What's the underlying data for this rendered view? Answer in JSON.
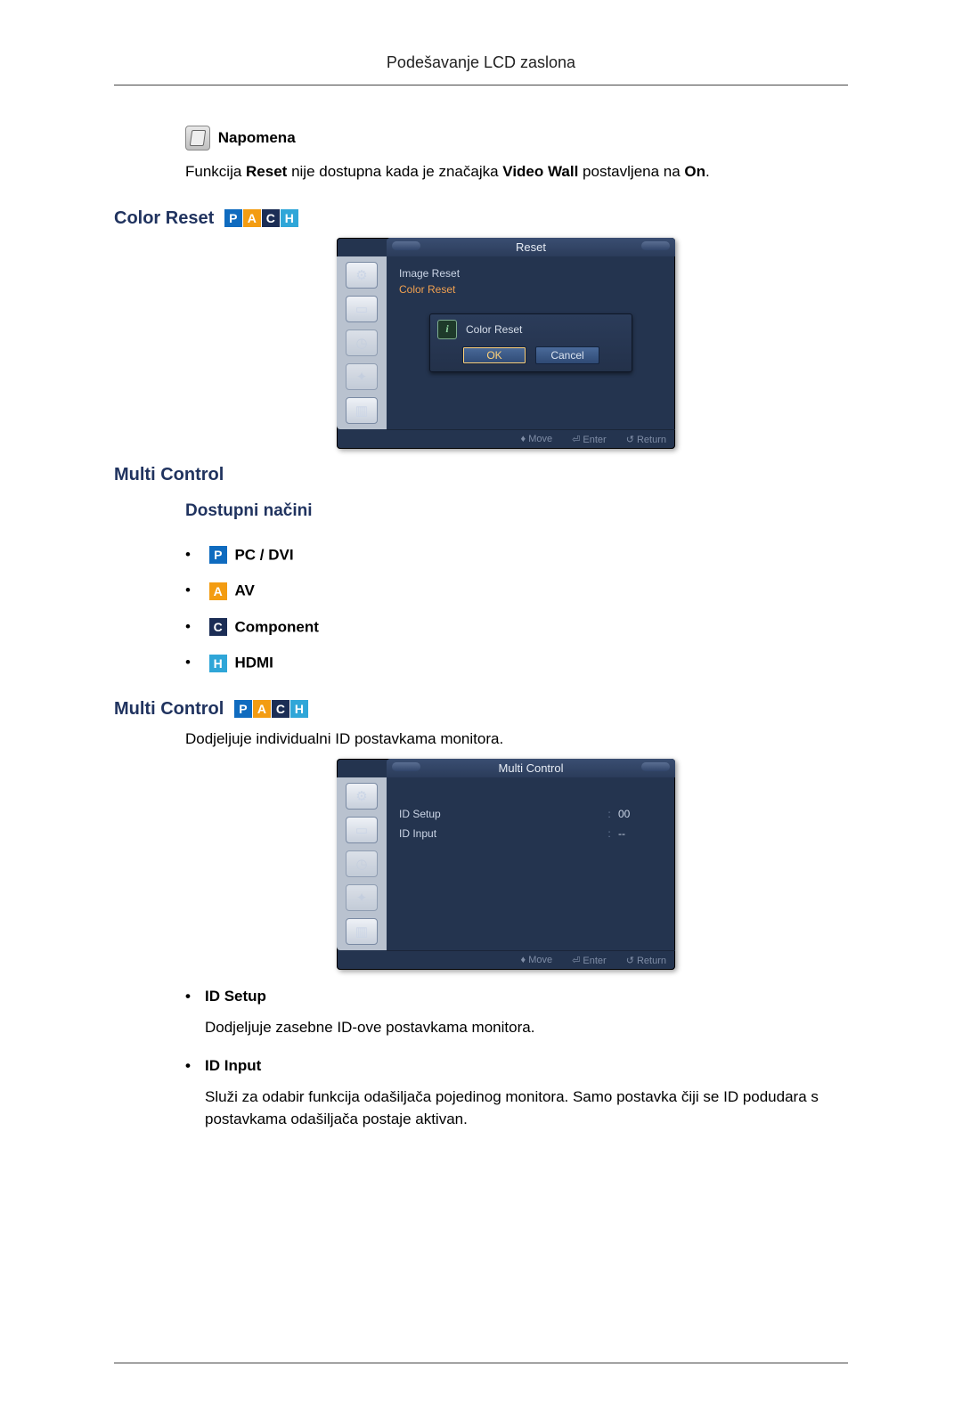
{
  "header": "Podešavanje LCD zaslona",
  "note_label": "Napomena",
  "note_body_prefix": "Funkcija ",
  "note_body_b1": "Reset",
  "note_body_mid": " nije dostupna kada je značajka ",
  "note_body_b2": "Video Wall",
  "note_body_after": " postavljena na ",
  "note_body_b3": "On",
  "note_body_end": ".",
  "section_color_reset": "Color Reset",
  "osd1": {
    "title": "Reset",
    "item1": "Image Reset",
    "item2": "Color Reset",
    "dialog_title": "Color Reset",
    "btn_ok": "OK",
    "btn_cancel": "Cancel",
    "foot_move": "Move",
    "foot_enter": "Enter",
    "foot_return": "Return"
  },
  "section_multi_control": "Multi Control",
  "subheading_modes": "Dostupni načini",
  "modes": {
    "pc": "PC / DVI",
    "av": "AV",
    "comp": "Component",
    "hdmi": "HDMI"
  },
  "badges": {
    "p": "P",
    "a": "A",
    "c": "C",
    "h": "H"
  },
  "section_multi_control2": "Multi Control",
  "mc_intro": "Dodjeljuje individualni ID postavkama monitora.",
  "osd2": {
    "title": "Multi Control",
    "row1_label": "ID Setup",
    "row1_val": "00",
    "row2_label": "ID Input",
    "row2_val": "--",
    "foot_move": "Move",
    "foot_enter": "Enter",
    "foot_return": "Return"
  },
  "desc": {
    "id_setup_t": "ID Setup",
    "id_setup_b": "Dodjeljuje zasebne ID-ove postavkama monitora.",
    "id_input_t": "ID Input",
    "id_input_b": "Služi za odabir funkcija odašiljača pojedinog monitora. Samo postavka čiji se ID podudara s postavkama odašiljača postaje aktivan."
  }
}
